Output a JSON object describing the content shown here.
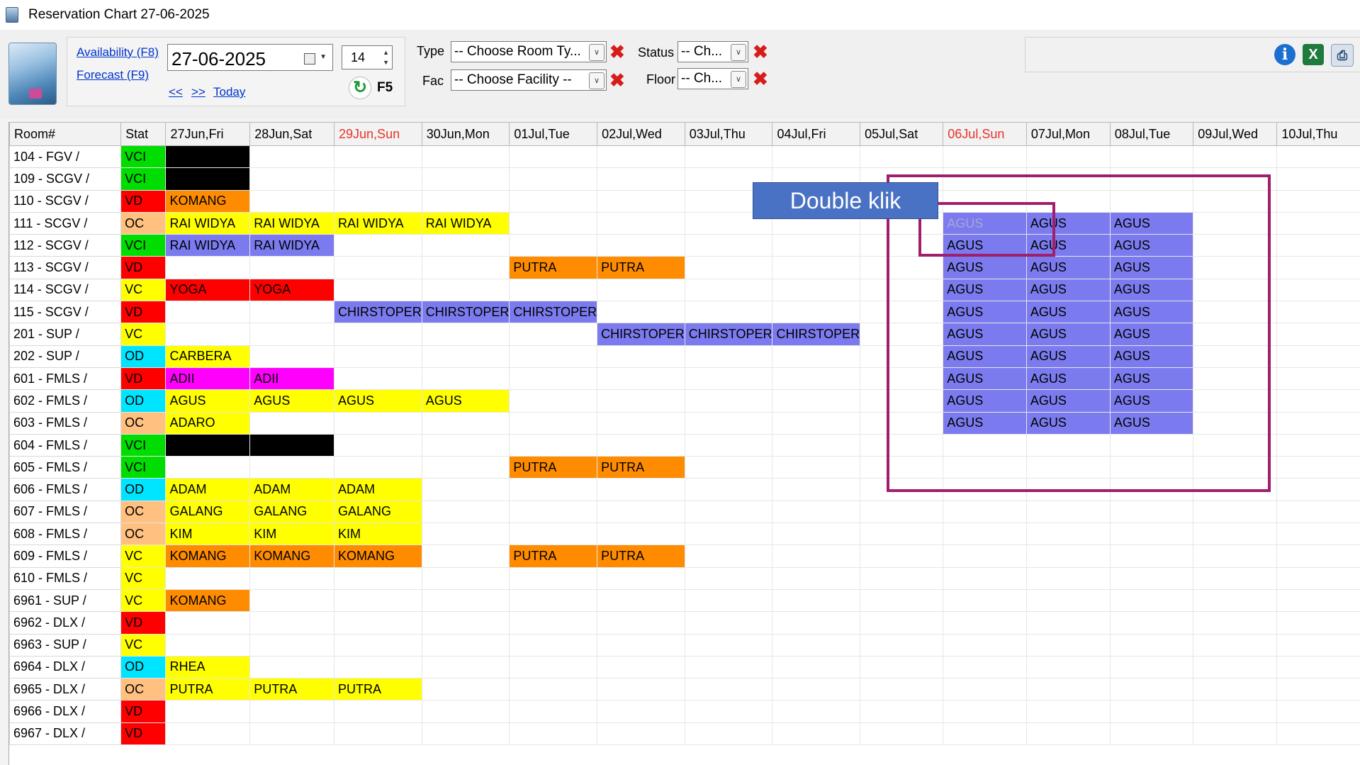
{
  "window": {
    "title": "Reservation Chart 27-06-2025"
  },
  "toolbar": {
    "availability_link": "Availability (F8)",
    "forecast_link": "Forecast (F9)",
    "prev_link": "<<",
    "next_link": ">>",
    "today_link": "Today",
    "date_value": "27-06-2025",
    "days_value": "14",
    "refresh_label": "F5",
    "type_label": "Type",
    "type_value": "-- Choose Room Ty...",
    "fac_label": "Fac",
    "fac_value": "-- Choose Facility --",
    "status_label": "Status",
    "status_value": "-- Ch...",
    "floor_label": "Floor",
    "floor_value": "-- Ch..."
  },
  "annotation": {
    "callout_text": "Double klik"
  },
  "grid": {
    "headers": [
      "Room#",
      "Stat",
      "27Jun,Fri",
      "28Jun,Sat",
      "29Jun,Sun",
      "30Jun,Mon",
      "01Jul,Tue",
      "02Jul,Wed",
      "03Jul,Thu",
      "04Jul,Fri",
      "05Jul,Sat",
      "06Jul,Sun",
      "07Jul,Mon",
      "08Jul,Tue",
      "09Jul,Wed",
      "10Jul,Thu"
    ],
    "weekend_header_indexes": [
      4,
      11
    ],
    "rows": [
      {
        "room": "104 - FGV /",
        "stat": "VCI",
        "cells": [
          {
            "d": 0,
            "t": "",
            "c": "black"
          }
        ]
      },
      {
        "room": "109 - SCGV /",
        "stat": "VCI",
        "cells": [
          {
            "d": 0,
            "t": "",
            "c": "black"
          }
        ]
      },
      {
        "room": "110 - SCGV /",
        "stat": "VD",
        "cells": [
          {
            "d": 0,
            "t": "KOMANG",
            "c": "orange"
          }
        ]
      },
      {
        "room": "111 - SCGV /",
        "stat": "OC",
        "cells": [
          {
            "d": 0,
            "t": "RAI WIDYA",
            "c": "yellow"
          },
          {
            "d": 1,
            "t": "RAI WIDYA",
            "c": "yellow"
          },
          {
            "d": 2,
            "t": "RAI WIDYA",
            "c": "yellow"
          },
          {
            "d": 3,
            "t": "RAI WIDYA",
            "c": "yellow"
          },
          {
            "d": 9,
            "t": "AGUS",
            "c": "purple",
            "sel": true
          },
          {
            "d": 10,
            "t": "AGUS",
            "c": "purple"
          },
          {
            "d": 11,
            "t": "AGUS",
            "c": "purple"
          }
        ]
      },
      {
        "room": "112 - SCGV /",
        "stat": "VCI",
        "cells": [
          {
            "d": 0,
            "t": "RAI WIDYA",
            "c": "purple"
          },
          {
            "d": 1,
            "t": "RAI WIDYA",
            "c": "purple"
          },
          {
            "d": 9,
            "t": "AGUS",
            "c": "purple"
          },
          {
            "d": 10,
            "t": "AGUS",
            "c": "purple"
          },
          {
            "d": 11,
            "t": "AGUS",
            "c": "purple"
          }
        ]
      },
      {
        "room": "113 - SCGV /",
        "stat": "VD",
        "cells": [
          {
            "d": 4,
            "t": "PUTRA",
            "c": "orange"
          },
          {
            "d": 5,
            "t": "PUTRA",
            "c": "orange"
          },
          {
            "d": 9,
            "t": "AGUS",
            "c": "purple"
          },
          {
            "d": 10,
            "t": "AGUS",
            "c": "purple"
          },
          {
            "d": 11,
            "t": "AGUS",
            "c": "purple"
          }
        ]
      },
      {
        "room": "114 - SCGV /",
        "stat": "VC",
        "cells": [
          {
            "d": 0,
            "t": "YOGA",
            "c": "red"
          },
          {
            "d": 1,
            "t": "YOGA",
            "c": "red"
          },
          {
            "d": 9,
            "t": "AGUS",
            "c": "purple"
          },
          {
            "d": 10,
            "t": "AGUS",
            "c": "purple"
          },
          {
            "d": 11,
            "t": "AGUS",
            "c": "purple"
          }
        ]
      },
      {
        "room": "115 - SCGV /",
        "stat": "VD",
        "cells": [
          {
            "d": 2,
            "t": "CHIRSTOPER",
            "c": "purple"
          },
          {
            "d": 3,
            "t": "CHIRSTOPER",
            "c": "purple"
          },
          {
            "d": 4,
            "t": "CHIRSTOPER",
            "c": "purple"
          },
          {
            "d": 9,
            "t": "AGUS",
            "c": "purple"
          },
          {
            "d": 10,
            "t": "AGUS",
            "c": "purple"
          },
          {
            "d": 11,
            "t": "AGUS",
            "c": "purple"
          }
        ]
      },
      {
        "room": "201 - SUP /",
        "stat": "VC",
        "cells": [
          {
            "d": 5,
            "t": "CHIRSTOPER",
            "c": "purple"
          },
          {
            "d": 6,
            "t": "CHIRSTOPER",
            "c": "purple"
          },
          {
            "d": 7,
            "t": "CHIRSTOPER",
            "c": "purple"
          },
          {
            "d": 9,
            "t": "AGUS",
            "c": "purple"
          },
          {
            "d": 10,
            "t": "AGUS",
            "c": "purple"
          },
          {
            "d": 11,
            "t": "AGUS",
            "c": "purple"
          }
        ]
      },
      {
        "room": "202 - SUP /",
        "stat": "OD",
        "cells": [
          {
            "d": 0,
            "t": "CARBERA",
            "c": "yellow"
          },
          {
            "d": 9,
            "t": "AGUS",
            "c": "purple"
          },
          {
            "d": 10,
            "t": "AGUS",
            "c": "purple"
          },
          {
            "d": 11,
            "t": "AGUS",
            "c": "purple"
          }
        ]
      },
      {
        "room": "601 - FMLS /",
        "stat": "VD",
        "cells": [
          {
            "d": 0,
            "t": "ADII",
            "c": "magenta"
          },
          {
            "d": 1,
            "t": "ADII",
            "c": "magenta"
          },
          {
            "d": 9,
            "t": "AGUS",
            "c": "purple"
          },
          {
            "d": 10,
            "t": "AGUS",
            "c": "purple"
          },
          {
            "d": 11,
            "t": "AGUS",
            "c": "purple"
          }
        ]
      },
      {
        "room": "602 - FMLS /",
        "stat": "OD",
        "cells": [
          {
            "d": 0,
            "t": "AGUS",
            "c": "yellow"
          },
          {
            "d": 1,
            "t": "AGUS",
            "c": "yellow"
          },
          {
            "d": 2,
            "t": "AGUS",
            "c": "yellow"
          },
          {
            "d": 3,
            "t": "AGUS",
            "c": "yellow"
          },
          {
            "d": 9,
            "t": "AGUS",
            "c": "purple"
          },
          {
            "d": 10,
            "t": "AGUS",
            "c": "purple"
          },
          {
            "d": 11,
            "t": "AGUS",
            "c": "purple"
          }
        ]
      },
      {
        "room": "603 - FMLS /",
        "stat": "OC",
        "cells": [
          {
            "d": 0,
            "t": "ADARO",
            "c": "yellow"
          },
          {
            "d": 9,
            "t": "AGUS",
            "c": "purple"
          },
          {
            "d": 10,
            "t": "AGUS",
            "c": "purple"
          },
          {
            "d": 11,
            "t": "AGUS",
            "c": "purple"
          }
        ]
      },
      {
        "room": "604 - FMLS /",
        "stat": "VCI",
        "cells": [
          {
            "d": 0,
            "t": "",
            "c": "black"
          },
          {
            "d": 1,
            "t": "",
            "c": "black"
          }
        ]
      },
      {
        "room": "605 - FMLS /",
        "stat": "VCI",
        "cells": [
          {
            "d": 4,
            "t": "PUTRA",
            "c": "orange"
          },
          {
            "d": 5,
            "t": "PUTRA",
            "c": "orange"
          }
        ]
      },
      {
        "room": "606 - FMLS /",
        "stat": "OD",
        "cells": [
          {
            "d": 0,
            "t": "ADAM",
            "c": "yellow"
          },
          {
            "d": 1,
            "t": "ADAM",
            "c": "yellow"
          },
          {
            "d": 2,
            "t": "ADAM",
            "c": "yellow"
          }
        ]
      },
      {
        "room": "607 - FMLS /",
        "stat": "OC",
        "cells": [
          {
            "d": 0,
            "t": "GALANG",
            "c": "yellow"
          },
          {
            "d": 1,
            "t": "GALANG",
            "c": "yellow"
          },
          {
            "d": 2,
            "t": "GALANG",
            "c": "yellow"
          }
        ]
      },
      {
        "room": "608 - FMLS /",
        "stat": "OC",
        "cells": [
          {
            "d": 0,
            "t": "KIM",
            "c": "yellow"
          },
          {
            "d": 1,
            "t": "KIM",
            "c": "yellow"
          },
          {
            "d": 2,
            "t": "KIM",
            "c": "yellow"
          }
        ]
      },
      {
        "room": "609 - FMLS /",
        "stat": "VC",
        "cells": [
          {
            "d": 0,
            "t": "KOMANG",
            "c": "orange"
          },
          {
            "d": 1,
            "t": "KOMANG",
            "c": "orange"
          },
          {
            "d": 2,
            "t": "KOMANG",
            "c": "orange"
          },
          {
            "d": 4,
            "t": "PUTRA",
            "c": "orange"
          },
          {
            "d": 5,
            "t": "PUTRA",
            "c": "orange"
          }
        ]
      },
      {
        "room": "610 - FMLS /",
        "stat": "VC",
        "cells": []
      },
      {
        "room": "6961 - SUP /",
        "stat": "VC",
        "cells": [
          {
            "d": 0,
            "t": "KOMANG",
            "c": "orange"
          }
        ]
      },
      {
        "room": "6962 - DLX /",
        "stat": "VD",
        "cells": []
      },
      {
        "room": "6963 - SUP /",
        "stat": "VC",
        "cells": []
      },
      {
        "room": "6964 - DLX /",
        "stat": "OD",
        "cells": [
          {
            "d": 0,
            "t": "RHEA",
            "c": "yellow"
          }
        ]
      },
      {
        "room": "6965 - DLX /",
        "stat": "OC",
        "cells": [
          {
            "d": 0,
            "t": "PUTRA",
            "c": "yellow"
          },
          {
            "d": 1,
            "t": "PUTRA",
            "c": "yellow"
          },
          {
            "d": 2,
            "t": "PUTRA",
            "c": "yellow"
          }
        ]
      },
      {
        "room": "6966 - DLX /",
        "stat": "VD",
        "cells": []
      },
      {
        "room": "6967 - DLX /",
        "stat": "VD",
        "cells": []
      }
    ]
  },
  "colors": {
    "black": "#000000",
    "orange": "#ff8c00",
    "yellow": "#ffff00",
    "purple": "#7b7bef",
    "red": "#ff0000",
    "magenta": "#ff00ff",
    "VCI": "#00dd00",
    "VD": "#ff0000",
    "OC": "#ffc080",
    "VC": "#ffff00",
    "OD": "#00e5ff",
    "highlight": "#a11e6b",
    "callout": "#4a72c4"
  },
  "icons": [
    "app-icon",
    "hotel-icon",
    "calendar-icon",
    "refresh-icon",
    "clear-x-icon",
    "info-icon",
    "excel-icon",
    "printer-icon"
  ]
}
